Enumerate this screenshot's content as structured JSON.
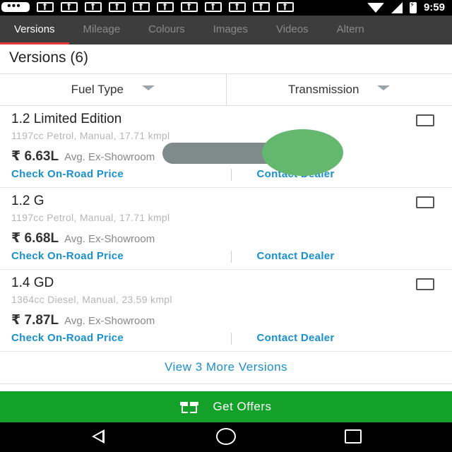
{
  "status_bar": {
    "time": "9:59",
    "notification_icons": [
      "chat-icon",
      "facebook-icon",
      "facebook-icon",
      "facebook-icon",
      "facebook-icon",
      "facebook-icon",
      "facebook-icon",
      "facebook-icon",
      "facebook-icon",
      "facebook-icon",
      "facebook-icon",
      "facebook-icon"
    ],
    "system_icons": [
      "wifi-icon",
      "signal-icon",
      "battery-charging-icon"
    ]
  },
  "tabs": [
    {
      "label": "Versions",
      "active": true
    },
    {
      "label": "Mileage",
      "active": false
    },
    {
      "label": "Colours",
      "active": false
    },
    {
      "label": "Images",
      "active": false
    },
    {
      "label": "Videos",
      "active": false
    },
    {
      "label": "Altern",
      "active": false
    }
  ],
  "section_title": "Versions (6)",
  "filters": {
    "fuel_type": "Fuel Type",
    "transmission": "Transmission"
  },
  "versions": [
    {
      "name": "1.2 Limited Edition",
      "specs": "1197cc Petrol, Manual, 17.71 kmpl",
      "price": "₹ 6.63L",
      "price_label": "Avg. Ex-Showroom",
      "on_road_label": "Check On-Road Price",
      "dealer_label": "Contact Dealer"
    },
    {
      "name": "1.2 G",
      "specs": "1197cc Petrol, Manual, 17.71 kmpl",
      "price": "₹ 6.68L",
      "price_label": "Avg. Ex-Showroom",
      "on_road_label": "Check On-Road Price",
      "dealer_label": "Contact Dealer"
    },
    {
      "name": "1.4 GD",
      "specs": "1364cc Diesel, Manual, 23.59 kmpl",
      "price": "₹ 7.87L",
      "price_label": "Avg. Ex-Showroom",
      "on_road_label": "Check On-Road Price",
      "dealer_label": "Contact Dealer"
    }
  ],
  "view_more_label": "View 3 More Versions",
  "get_offers_label": "Get Offers",
  "colors": {
    "tab_bar": "#3d3d3d",
    "active_tab_underline": "#e53935",
    "link_blue": "#1a8fce",
    "offers_green": "#14a12a"
  }
}
